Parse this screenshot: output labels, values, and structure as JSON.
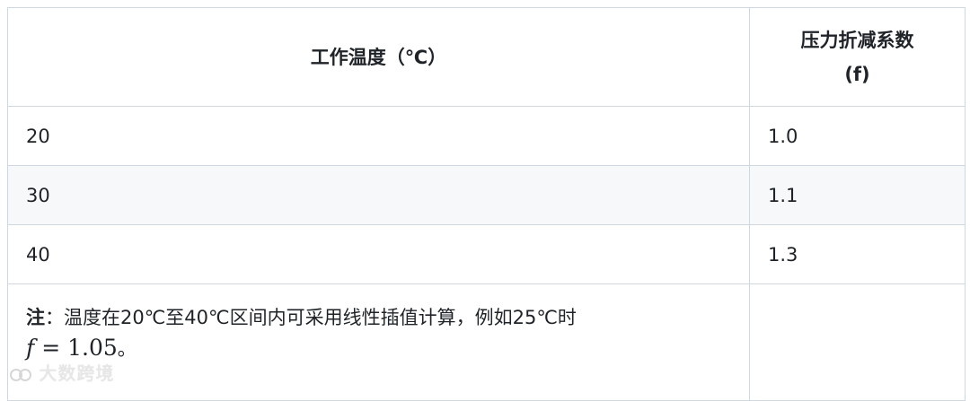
{
  "table": {
    "headers": [
      "工作温度（℃）",
      "压力折减系数",
      "(f)"
    ],
    "rows": [
      {
        "temp": "20",
        "factor": "1.0"
      },
      {
        "temp": "30",
        "factor": "1.1"
      },
      {
        "temp": "40",
        "factor": "1.3"
      }
    ],
    "note": {
      "label": "注",
      "text": "：温度在20℃至40℃区间内可采用线性插值计算，例如25℃时",
      "formula_var": "f",
      "formula_rest": " = 1.05",
      "formula_end": "。"
    }
  },
  "watermark": {
    "text": "大数跨境",
    "icon": "logo-icon"
  }
}
